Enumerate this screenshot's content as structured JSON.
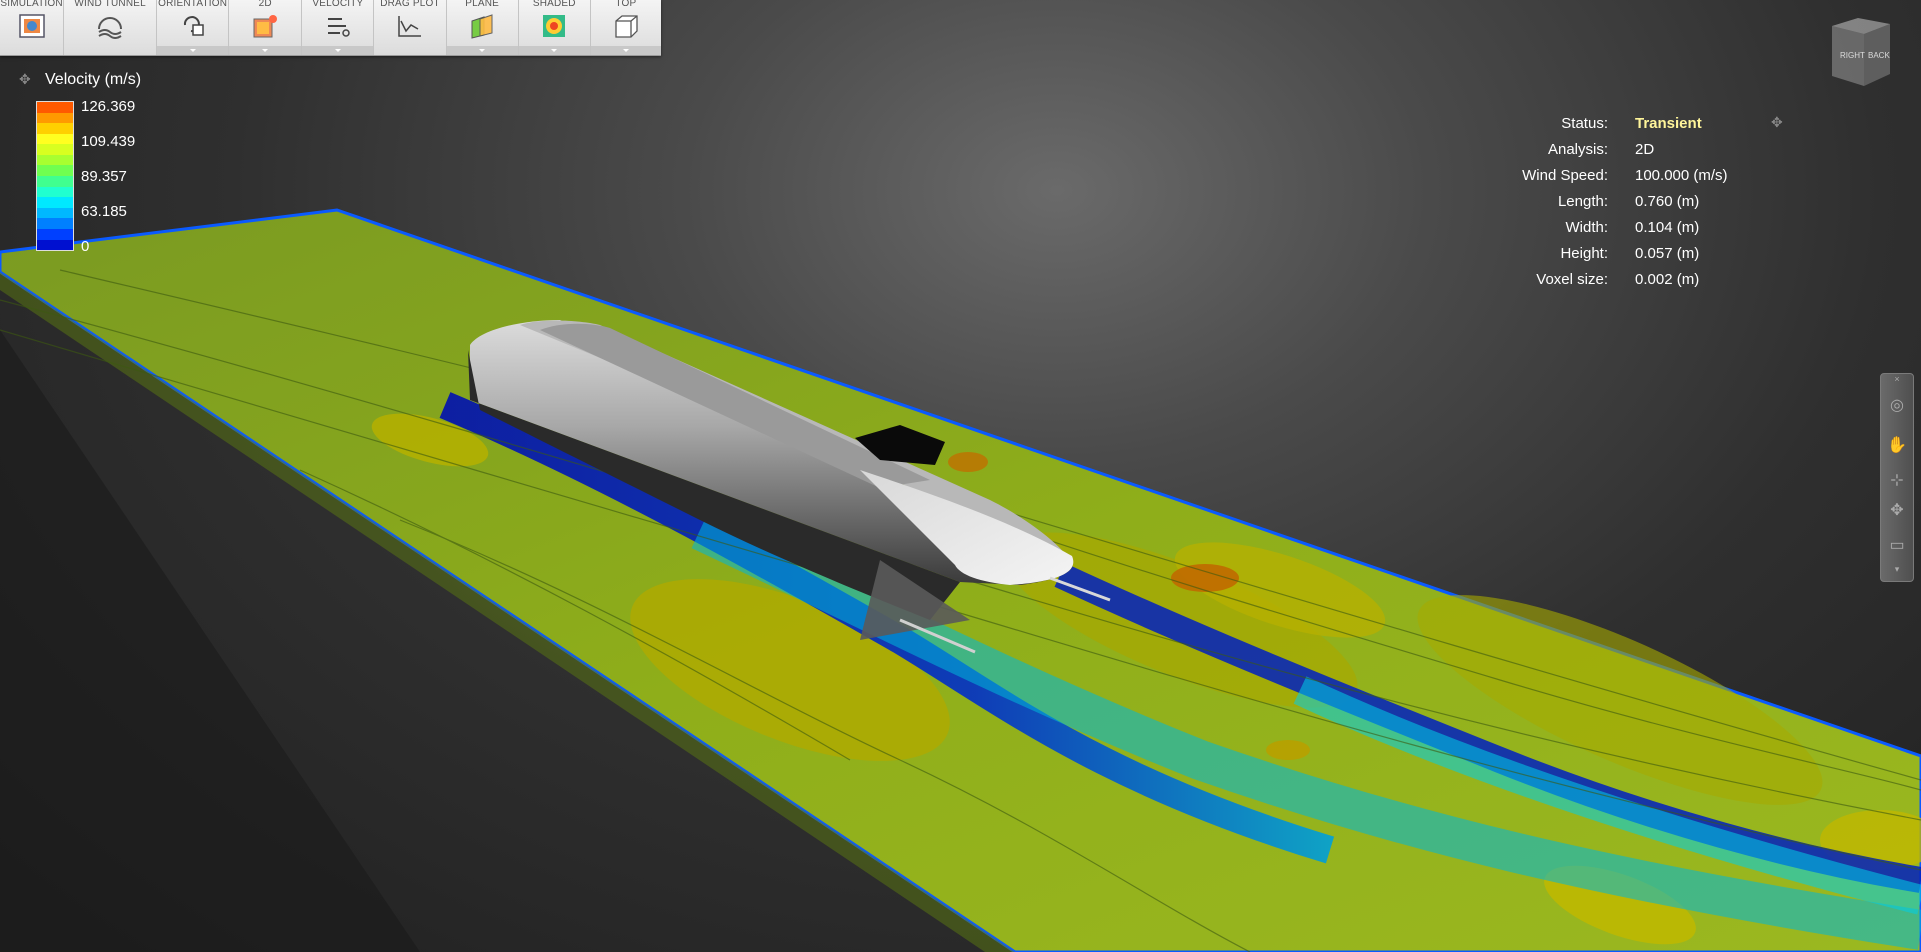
{
  "toolbar": {
    "items": [
      {
        "label": "SIMULATION",
        "icon": "simulation-icon"
      },
      {
        "label": "WIND TUNNEL",
        "icon": "wind-tunnel-icon"
      },
      {
        "label": "ORIENTATION",
        "icon": "orientation-icon"
      },
      {
        "label": "2D",
        "icon": "2d-icon"
      },
      {
        "label": "VELOCITY",
        "icon": "velocity-icon"
      },
      {
        "label": "DRAG PLOT",
        "icon": "drag-plot-icon"
      },
      {
        "label": "PLANE",
        "icon": "plane-icon"
      },
      {
        "label": "SHADED",
        "icon": "shaded-icon"
      },
      {
        "label": "TOP",
        "icon": "top-view-icon"
      }
    ]
  },
  "legend": {
    "title": "Velocity (m/s)",
    "values": [
      "126.369",
      "109.439",
      "89.357",
      "63.185",
      "0"
    ],
    "colors": [
      "#ff5a00",
      "#ff9a00",
      "#ffd000",
      "#ffff20",
      "#d8ff20",
      "#a8ff30",
      "#70ff50",
      "#40ff90",
      "#20ffd0",
      "#00e8ff",
      "#00b8ff",
      "#0080ff",
      "#0040ff",
      "#0010d0"
    ]
  },
  "status": {
    "rows": [
      {
        "label": "Status:",
        "value": "Transient"
      },
      {
        "label": "Analysis:",
        "value": "2D"
      },
      {
        "label": "Wind Speed:",
        "value": "100.000 (m/s)"
      },
      {
        "label": "Length:",
        "value": "0.760 (m)"
      },
      {
        "label": "Width:",
        "value": "0.104 (m)"
      },
      {
        "label": "Height:",
        "value": "0.057 (m)"
      },
      {
        "label": "Voxel size:",
        "value": "0.002 (m)"
      }
    ]
  },
  "viewcube": {
    "faces": [
      "RIGHT",
      "BACK"
    ]
  },
  "colors": {
    "accent": "#fff59a",
    "plane_base": "#8fae1a",
    "wake": "#0a1ea8"
  }
}
